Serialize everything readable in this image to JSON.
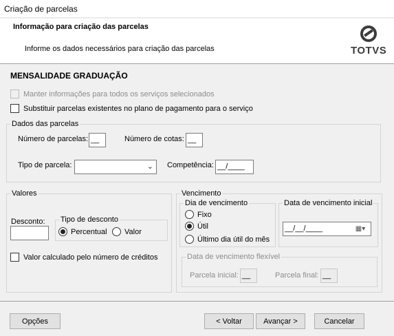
{
  "window": {
    "title": "Criação de parcelas"
  },
  "header": {
    "title": "Informação para criação das parcelas",
    "subtitle": "Informe os dados necessários para criação das parcelas",
    "logo_text": "TOTVS"
  },
  "section_title": "MENSALIDADE GRADUAÇÃO",
  "options": {
    "keep_info": "Manter informações para todos os serviços selecionados",
    "replace": "Substituir parcelas existentes no plano de pagamento para o serviço"
  },
  "dados": {
    "legend": "Dados das parcelas",
    "num_parcelas_label": "Número de parcelas:",
    "num_parcelas_value": "__",
    "num_cotas_label": "Número de cotas:",
    "num_cotas_value": "__",
    "tipo_label": "Tipo de parcela:",
    "tipo_value": "",
    "competencia_label": "Competência:",
    "competencia_value": "__/____"
  },
  "valores": {
    "legend": "Valores",
    "desconto_label": "Desconto:",
    "desconto_value": "",
    "tipo_desconto_legend": "Tipo de desconto",
    "percentual": "Percentual",
    "valor": "Valor",
    "calc_creditos": "Valor calculado pelo número de créditos",
    "selected": "Percentual"
  },
  "vencimento": {
    "legend": "Vencimento",
    "dia_legend": "Dia de vencimento",
    "fixo": "Fixo",
    "util": "Útil",
    "ultimo": "Último dia útil do mês",
    "selected": "Útil",
    "data_inicial_legend": "Data de vencimento inicial",
    "data_inicial_value": "__/__/____",
    "flexivel_legend": "Data de vencimento flexível",
    "parcela_inicial_label": "Parcela inicial:",
    "parcela_inicial_value": "__",
    "parcela_final_label": "Parcela final:",
    "parcela_final_value": "__"
  },
  "buttons": {
    "opcoes": "Opções",
    "voltar": "< Voltar",
    "avancar": "Avançar >",
    "cancelar": "Cancelar"
  }
}
